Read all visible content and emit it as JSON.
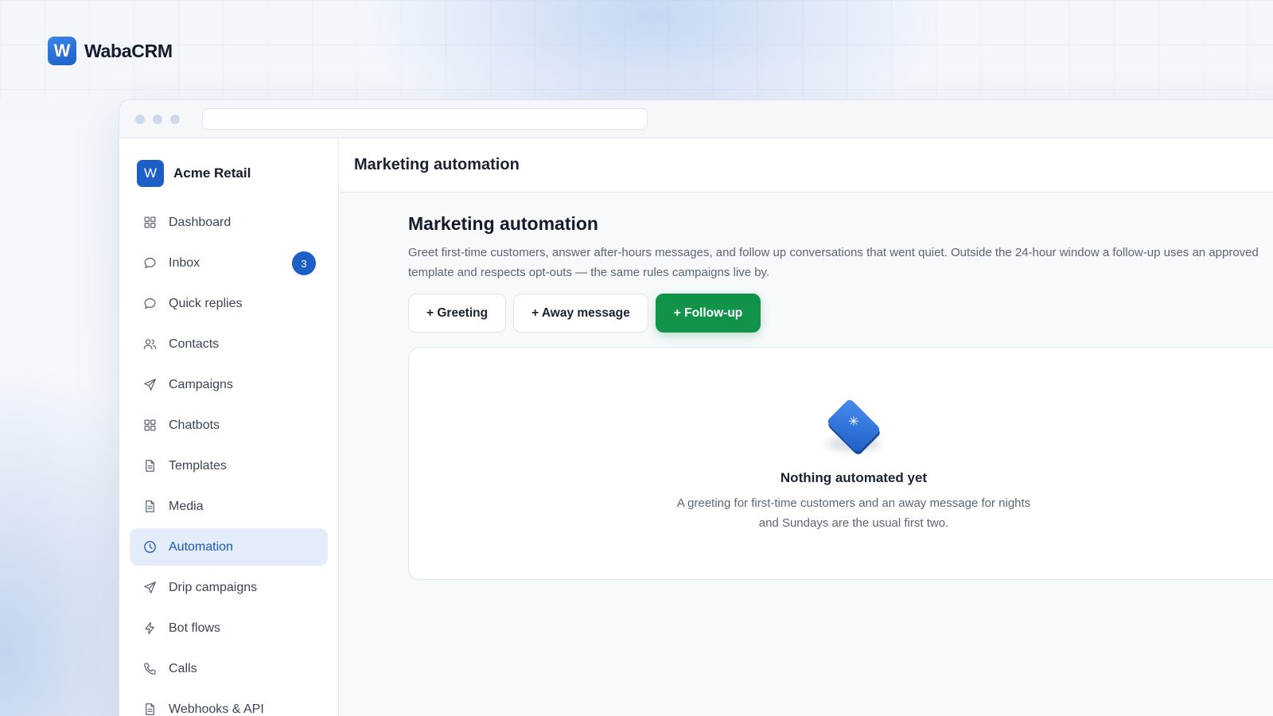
{
  "brand": {
    "name": "WabaCRM",
    "logo_letter": "W"
  },
  "org": {
    "name": "Acme Retail",
    "logo_letter": "W"
  },
  "sidebar": {
    "items": [
      {
        "label": "Dashboard",
        "icon": "grid-icon"
      },
      {
        "label": "Inbox",
        "icon": "chat-bubble-icon",
        "badge": "3"
      },
      {
        "label": "Quick replies",
        "icon": "chat-bubble-icon"
      },
      {
        "label": "Contacts",
        "icon": "users-icon"
      },
      {
        "label": "Campaigns",
        "icon": "send-icon"
      },
      {
        "label": "Chatbots",
        "icon": "grid-icon"
      },
      {
        "label": "Templates",
        "icon": "document-icon"
      },
      {
        "label": "Media",
        "icon": "document-icon"
      },
      {
        "label": "Automation",
        "icon": "clock-icon",
        "active": true
      },
      {
        "label": "Drip campaigns",
        "icon": "send-icon"
      },
      {
        "label": "Bot flows",
        "icon": "lightning-icon"
      },
      {
        "label": "Calls",
        "icon": "phone-icon"
      },
      {
        "label": "Webhooks & API",
        "icon": "document-icon"
      }
    ]
  },
  "header": {
    "title": "Marketing automation"
  },
  "main": {
    "title": "Marketing automation",
    "description": "Greet first-time customers, answer after-hours messages, and follow up conversations that went quiet. Outside the 24-hour window a follow-up uses an approved template and respects opt-outs — the same rules campaigns live by.",
    "buttons": {
      "greeting": "+ Greeting",
      "away": "+ Away message",
      "followup": "+ Follow-up"
    },
    "empty_state": {
      "title": "Nothing automated yet",
      "text": "A greeting for first-time customers and an away message for nights and Sundays are the usual first two."
    }
  },
  "colors": {
    "accent": "#1d5fc7",
    "primary_button": "#11944a",
    "active_nav_bg": "#e3ecf8"
  }
}
